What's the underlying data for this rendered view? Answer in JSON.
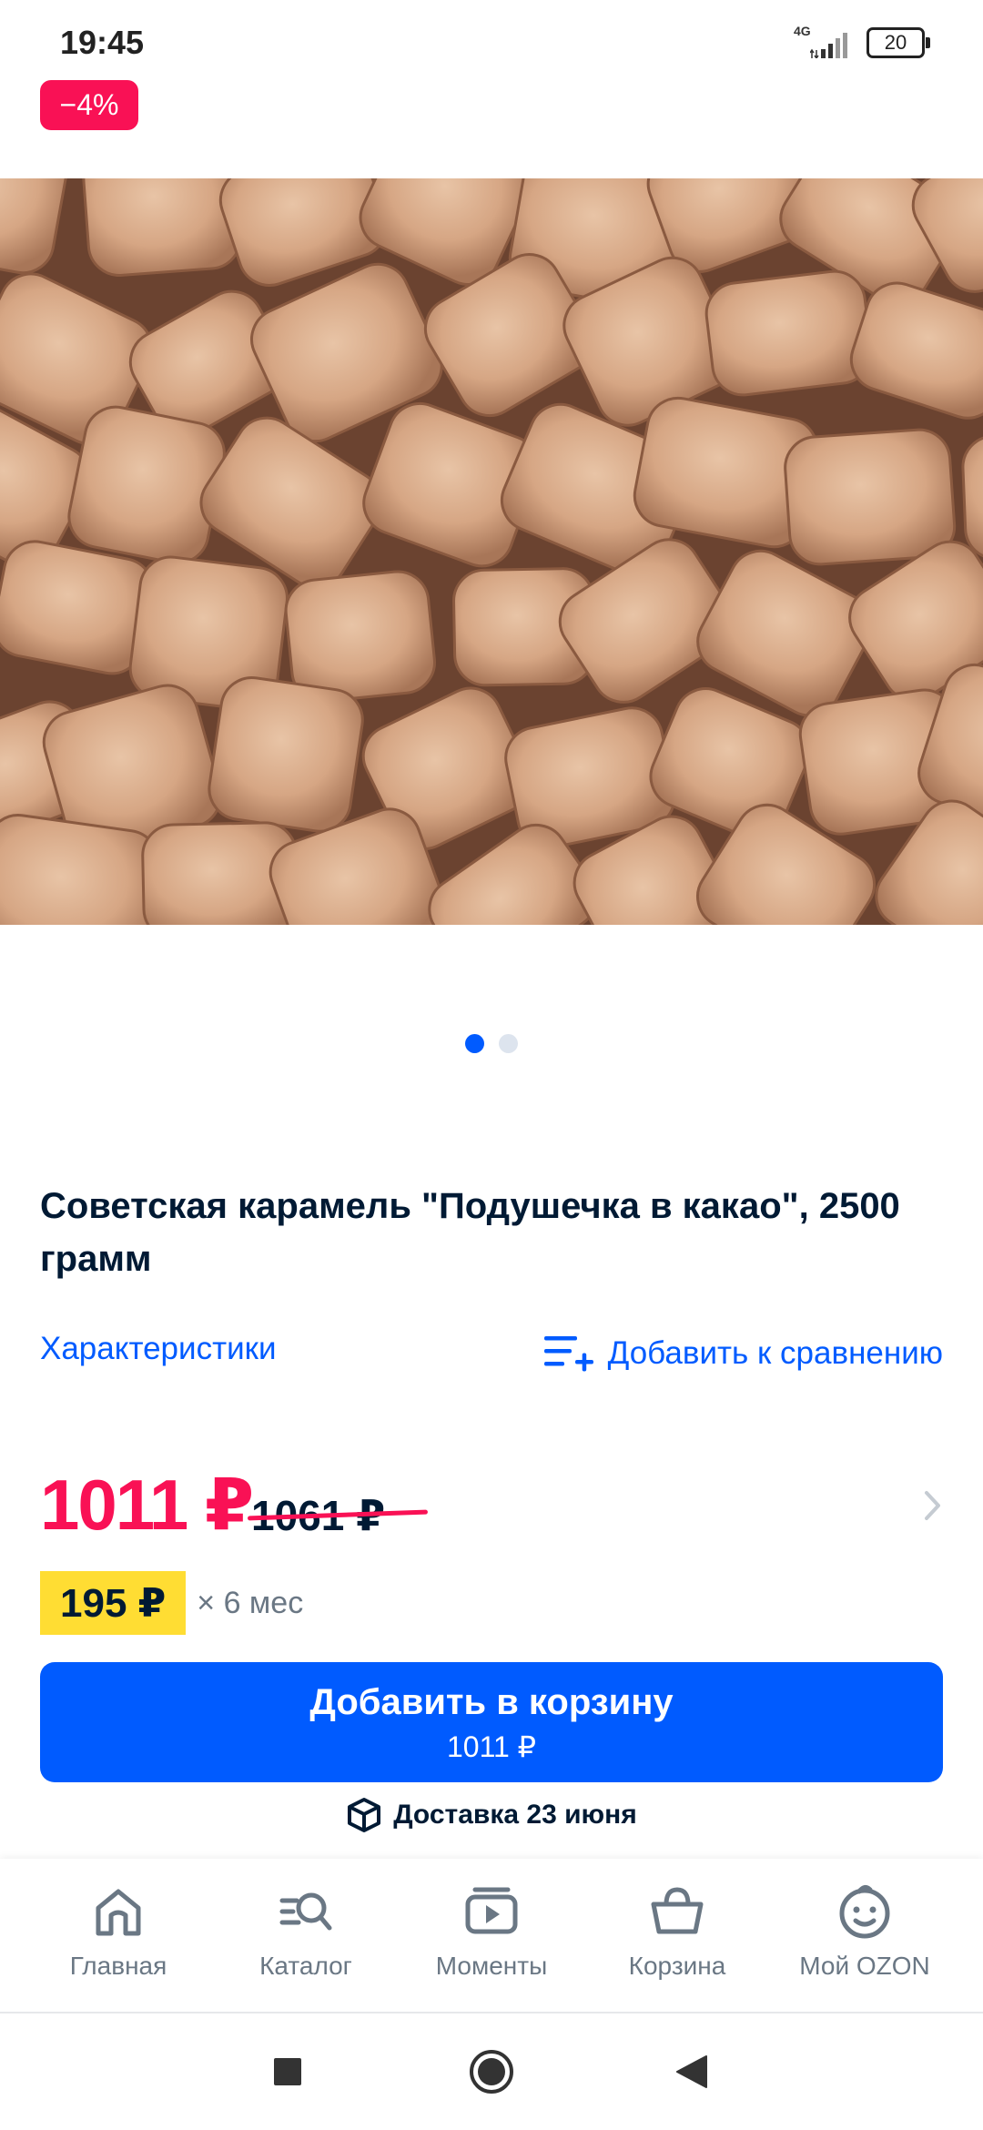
{
  "status_bar": {
    "time": "19:45",
    "network": "4G",
    "battery": "20"
  },
  "badge": {
    "discount": "−4%"
  },
  "gallery": {
    "total_images": 2,
    "active_index": 0
  },
  "product": {
    "title": "Советская карамель \"Подушечка в какао\", 2500 грамм"
  },
  "links": {
    "specs": "Характеристики",
    "compare": "Добавить к сравнению"
  },
  "price": {
    "current": "1011 ₽",
    "old": "1061 ₽"
  },
  "installment": {
    "amount": "195 ₽",
    "term": "× 6 мес"
  },
  "cart_button": {
    "label": "Добавить в корзину",
    "price": "1011 ₽"
  },
  "delivery": {
    "text": "Доставка 23 июня"
  },
  "bottom_nav": {
    "items": [
      {
        "label": "Главная",
        "icon": "home-icon"
      },
      {
        "label": "Каталог",
        "icon": "catalog-search-icon"
      },
      {
        "label": "Моменты",
        "icon": "video-moments-icon"
      },
      {
        "label": "Корзина",
        "icon": "basket-icon"
      },
      {
        "label": "Мой OZON",
        "icon": "smiley-profile-icon"
      }
    ]
  },
  "colors": {
    "brand_blue": "#005bff",
    "sale_red": "#f91155",
    "installment_yellow": "#ffdd33",
    "text_dark": "#001a34"
  }
}
